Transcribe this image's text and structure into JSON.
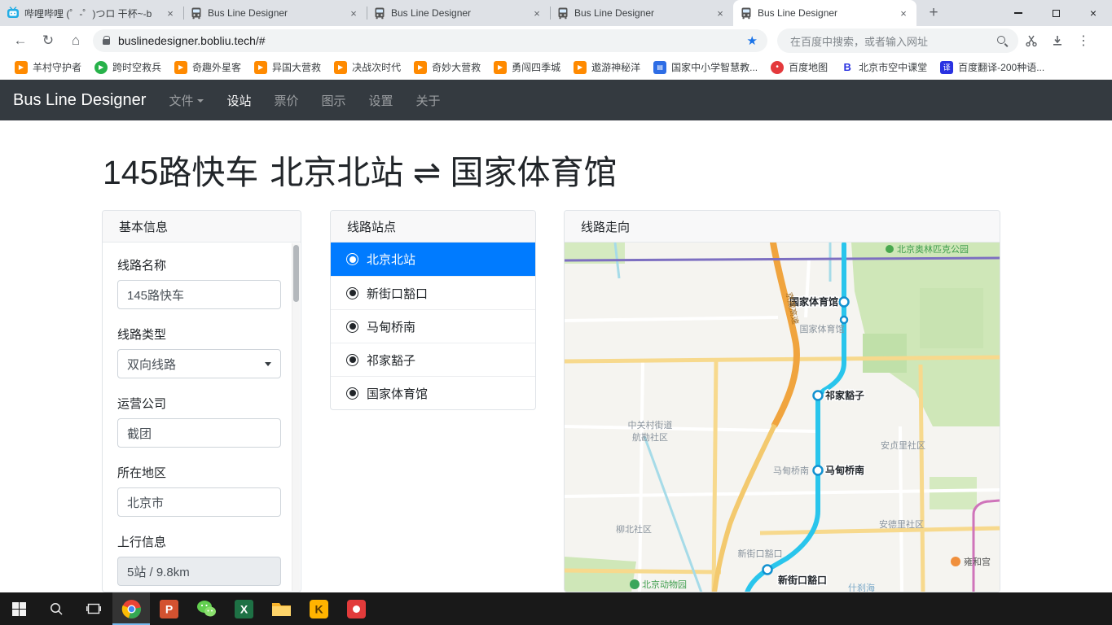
{
  "browser": {
    "tabs": [
      {
        "title": "哔哩哔哩 (゜-゜)つロ 干杯~-b",
        "favicon": "bilibili",
        "active": false
      },
      {
        "title": "Bus Line Designer",
        "favicon": "bus",
        "active": false
      },
      {
        "title": "Bus Line Designer",
        "favicon": "bus",
        "active": false
      },
      {
        "title": "Bus Line Designer",
        "favicon": "bus",
        "active": false
      },
      {
        "title": "Bus Line Designer",
        "favicon": "bus",
        "active": true
      }
    ],
    "url": "buslinedesigner.bobliu.tech/#",
    "search_placeholder": "在百度中搜索，或者输入网址",
    "bookmarks": [
      {
        "label": "羊村守护者",
        "icon": "tv-orange"
      },
      {
        "label": "跨时空救兵",
        "icon": "play-green"
      },
      {
        "label": "奇趣外星客",
        "icon": "tv-orange"
      },
      {
        "label": "异国大营救",
        "icon": "tv-orange"
      },
      {
        "label": "决战次时代",
        "icon": "tv-orange"
      },
      {
        "label": "奇妙大营救",
        "icon": "tv-orange"
      },
      {
        "label": "勇闯四季城",
        "icon": "tv-orange"
      },
      {
        "label": "遨游神秘洋",
        "icon": "tv-orange"
      },
      {
        "label": "国家中小学智慧教...",
        "icon": "edu-blue"
      },
      {
        "label": "百度地图",
        "icon": "pin-red"
      },
      {
        "label": "北京市空中课堂",
        "icon": "b-blue"
      },
      {
        "label": "百度翻译-200种语...",
        "icon": "trans-blue"
      }
    ]
  },
  "navbar": {
    "brand": "Bus Line Designer",
    "items": [
      {
        "label": "文件",
        "key": "file",
        "dropdown": true,
        "active": false
      },
      {
        "label": "设站",
        "key": "stations",
        "dropdown": false,
        "active": true
      },
      {
        "label": "票价",
        "key": "fare",
        "dropdown": false,
        "active": false
      },
      {
        "label": "图示",
        "key": "diagram",
        "dropdown": false,
        "active": false
      },
      {
        "label": "设置",
        "key": "settings",
        "dropdown": false,
        "active": false
      },
      {
        "label": "关于",
        "key": "about",
        "dropdown": false,
        "active": false
      }
    ]
  },
  "page": {
    "line_name": "145路快车",
    "line_route": "北京北站 ⇌ 国家体育馆"
  },
  "basic_info": {
    "header": "基本信息",
    "fields": [
      {
        "label": "线路名称",
        "value": "145路快车",
        "type": "input",
        "name": "line-name"
      },
      {
        "label": "线路类型",
        "value": "双向线路",
        "type": "select",
        "name": "line-type"
      },
      {
        "label": "运营公司",
        "value": "截团",
        "type": "input",
        "name": "operator"
      },
      {
        "label": "所在地区",
        "value": "北京市",
        "type": "input",
        "name": "region"
      },
      {
        "label": "上行信息",
        "value": "5站 / 9.8km",
        "type": "readonly",
        "name": "up-direction-info"
      }
    ]
  },
  "stations_panel": {
    "header": "线路站点",
    "stations": [
      {
        "name": "北京北站",
        "selected": true
      },
      {
        "name": "新街口豁口",
        "selected": false
      },
      {
        "name": "马甸桥南",
        "selected": false
      },
      {
        "name": "祁家豁子",
        "selected": false
      },
      {
        "name": "国家体育馆",
        "selected": false
      }
    ]
  },
  "map": {
    "header": "线路走向",
    "labels": {
      "park": "北京奥林匹克公园",
      "stadium_station": "国家体育馆",
      "stadium_area": "国家体育馆",
      "qijiahuozi": "祁家豁子",
      "madianqiaonan": "马甸桥南",
      "madian_road": "马甸桥南",
      "xinjiekou_station": "新街口豁口",
      "xinjiekou_road": "新街口豁口",
      "zhongguancun": "中关村街道",
      "hangkan": "航勘社区",
      "anzhenli": "安贞里社区",
      "liubei": "柳北社区",
      "andeli": "安德里社区",
      "yonghegong": "雍和宫",
      "zoo": "北京动物园",
      "shichahai": "什刹海",
      "highway": "京藏高速"
    }
  },
  "taskbar": {
    "items": [
      "start",
      "search",
      "task-view",
      "chrome",
      "powerpoint",
      "wechat",
      "excel",
      "explorer",
      "app-k",
      "recorder"
    ]
  }
}
